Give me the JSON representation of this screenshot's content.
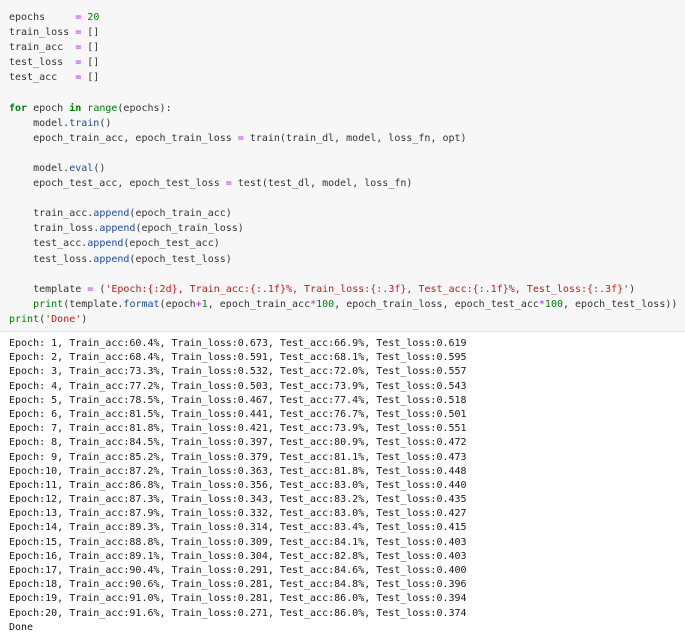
{
  "code_lines": [
    {
      "tokens": [
        {
          "t": "epochs     ",
          "c": ""
        },
        {
          "t": "=",
          "c": "op"
        },
        {
          "t": " ",
          "c": ""
        },
        {
          "t": "20",
          "c": "num"
        }
      ]
    },
    {
      "tokens": [
        {
          "t": "train_loss ",
          "c": ""
        },
        {
          "t": "=",
          "c": "op"
        },
        {
          "t": " []",
          "c": ""
        }
      ]
    },
    {
      "tokens": [
        {
          "t": "train_acc  ",
          "c": ""
        },
        {
          "t": "=",
          "c": "op"
        },
        {
          "t": " []",
          "c": ""
        }
      ]
    },
    {
      "tokens": [
        {
          "t": "test_loss  ",
          "c": ""
        },
        {
          "t": "=",
          "c": "op"
        },
        {
          "t": " []",
          "c": ""
        }
      ]
    },
    {
      "tokens": [
        {
          "t": "test_acc   ",
          "c": ""
        },
        {
          "t": "=",
          "c": "op"
        },
        {
          "t": " []",
          "c": ""
        }
      ]
    },
    {
      "tokens": [
        {
          "t": "",
          "c": ""
        }
      ]
    },
    {
      "tokens": [
        {
          "t": "for",
          "c": "kw"
        },
        {
          "t": " epoch ",
          "c": ""
        },
        {
          "t": "in",
          "c": "kw"
        },
        {
          "t": " ",
          "c": ""
        },
        {
          "t": "range",
          "c": "bi"
        },
        {
          "t": "(epochs):",
          "c": ""
        }
      ]
    },
    {
      "tokens": [
        {
          "t": "    model.",
          "c": ""
        },
        {
          "t": "train",
          "c": "attr"
        },
        {
          "t": "()",
          "c": ""
        }
      ]
    },
    {
      "tokens": [
        {
          "t": "    epoch_train_acc, epoch_train_loss ",
          "c": ""
        },
        {
          "t": "=",
          "c": "op"
        },
        {
          "t": " train(train_dl, model, loss_fn, opt)",
          "c": ""
        }
      ]
    },
    {
      "tokens": [
        {
          "t": "",
          "c": ""
        }
      ]
    },
    {
      "tokens": [
        {
          "t": "    model.",
          "c": ""
        },
        {
          "t": "eval",
          "c": "attr"
        },
        {
          "t": "()",
          "c": ""
        }
      ]
    },
    {
      "tokens": [
        {
          "t": "    epoch_test_acc, epoch_test_loss ",
          "c": ""
        },
        {
          "t": "=",
          "c": "op"
        },
        {
          "t": " test(test_dl, model, loss_fn)",
          "c": ""
        }
      ]
    },
    {
      "tokens": [
        {
          "t": "",
          "c": ""
        }
      ]
    },
    {
      "tokens": [
        {
          "t": "    train_acc.",
          "c": ""
        },
        {
          "t": "append",
          "c": "attr"
        },
        {
          "t": "(epoch_train_acc)",
          "c": ""
        }
      ]
    },
    {
      "tokens": [
        {
          "t": "    train_loss.",
          "c": ""
        },
        {
          "t": "append",
          "c": "attr"
        },
        {
          "t": "(epoch_train_loss)",
          "c": ""
        }
      ]
    },
    {
      "tokens": [
        {
          "t": "    test_acc.",
          "c": ""
        },
        {
          "t": "append",
          "c": "attr"
        },
        {
          "t": "(epoch_test_acc)",
          "c": ""
        }
      ]
    },
    {
      "tokens": [
        {
          "t": "    test_loss.",
          "c": ""
        },
        {
          "t": "append",
          "c": "attr"
        },
        {
          "t": "(epoch_test_loss)",
          "c": ""
        }
      ]
    },
    {
      "tokens": [
        {
          "t": "",
          "c": ""
        }
      ]
    },
    {
      "tokens": [
        {
          "t": "    template ",
          "c": ""
        },
        {
          "t": "=",
          "c": "op"
        },
        {
          "t": " (",
          "c": ""
        },
        {
          "t": "'Epoch:{:2d}, Train_acc:{:.1f}%, Train_loss:{:.3f}, Test_acc:{:.1f}%, Test_loss:{:.3f}'",
          "c": "str"
        },
        {
          "t": ")",
          "c": ""
        }
      ]
    },
    {
      "tokens": [
        {
          "t": "    ",
          "c": ""
        },
        {
          "t": "print",
          "c": "bi"
        },
        {
          "t": "(template.",
          "c": ""
        },
        {
          "t": "format",
          "c": "attr"
        },
        {
          "t": "(epoch",
          "c": ""
        },
        {
          "t": "+",
          "c": "op"
        },
        {
          "t": "1",
          "c": "num"
        },
        {
          "t": ", epoch_train_acc",
          "c": ""
        },
        {
          "t": "*",
          "c": "op"
        },
        {
          "t": "100",
          "c": "num"
        },
        {
          "t": ", epoch_train_loss, epoch_test_acc",
          "c": ""
        },
        {
          "t": "*",
          "c": "op"
        },
        {
          "t": "100",
          "c": "num"
        },
        {
          "t": ", epoch_test_loss))",
          "c": ""
        }
      ]
    },
    {
      "tokens": [
        {
          "t": "print",
          "c": "bi"
        },
        {
          "t": "(",
          "c": ""
        },
        {
          "t": "'Done'",
          "c": "str"
        },
        {
          "t": ")",
          "c": ""
        }
      ]
    }
  ],
  "output_lines": [
    "Epoch: 1, Train_acc:60.4%, Train_loss:0.673, Test_acc:66.9%, Test_loss:0.619",
    "Epoch: 2, Train_acc:68.4%, Train_loss:0.591, Test_acc:68.1%, Test_loss:0.595",
    "Epoch: 3, Train_acc:73.3%, Train_loss:0.532, Test_acc:72.0%, Test_loss:0.557",
    "Epoch: 4, Train_acc:77.2%, Train_loss:0.503, Test_acc:73.9%, Test_loss:0.543",
    "Epoch: 5, Train_acc:78.5%, Train_loss:0.467, Test_acc:77.4%, Test_loss:0.518",
    "Epoch: 6, Train_acc:81.5%, Train_loss:0.441, Test_acc:76.7%, Test_loss:0.501",
    "Epoch: 7, Train_acc:81.8%, Train_loss:0.421, Test_acc:73.9%, Test_loss:0.551",
    "Epoch: 8, Train_acc:84.5%, Train_loss:0.397, Test_acc:80.9%, Test_loss:0.472",
    "Epoch: 9, Train_acc:85.2%, Train_loss:0.379, Test_acc:81.1%, Test_loss:0.473",
    "Epoch:10, Train_acc:87.2%, Train_loss:0.363, Test_acc:81.8%, Test_loss:0.448",
    "Epoch:11, Train_acc:86.8%, Train_loss:0.356, Test_acc:83.0%, Test_loss:0.440",
    "Epoch:12, Train_acc:87.3%, Train_loss:0.343, Test_acc:83.2%, Test_loss:0.435",
    "Epoch:13, Train_acc:87.9%, Train_loss:0.332, Test_acc:83.0%, Test_loss:0.427",
    "Epoch:14, Train_acc:89.3%, Train_loss:0.314, Test_acc:83.4%, Test_loss:0.415",
    "Epoch:15, Train_acc:88.8%, Train_loss:0.309, Test_acc:84.1%, Test_loss:0.403",
    "Epoch:16, Train_acc:89.1%, Train_loss:0.304, Test_acc:82.8%, Test_loss:0.403",
    "Epoch:17, Train_acc:90.4%, Train_loss:0.291, Test_acc:84.6%, Test_loss:0.400",
    "Epoch:18, Train_acc:90.6%, Train_loss:0.281, Test_acc:84.8%, Test_loss:0.396",
    "Epoch:19, Train_acc:91.0%, Train_loss:0.281, Test_acc:86.0%, Test_loss:0.394",
    "Epoch:20, Train_acc:91.6%, Train_loss:0.271, Test_acc:86.0%, Test_loss:0.374",
    "Done"
  ]
}
